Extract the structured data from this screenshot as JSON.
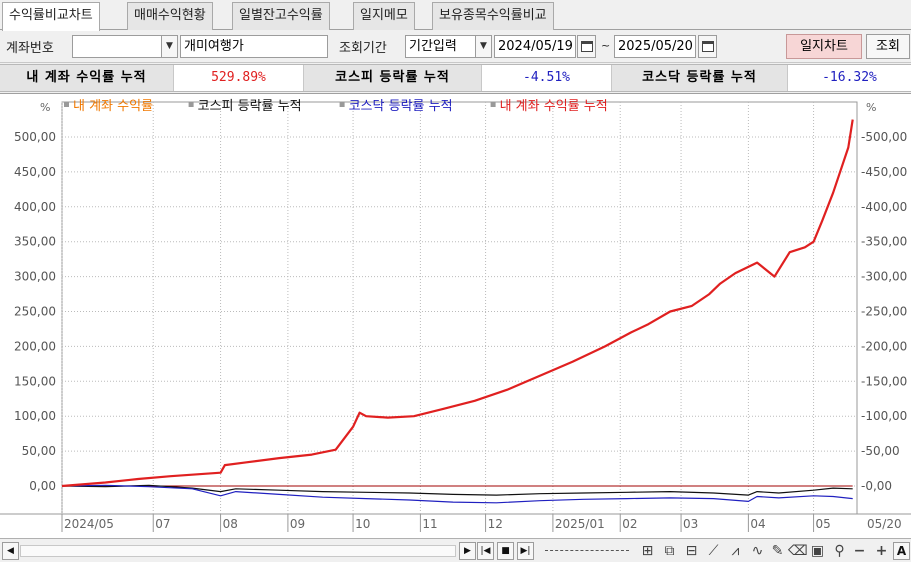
{
  "tabs": [
    {
      "label": "수익률비교차트",
      "active": true
    },
    {
      "label": "매매수익현황",
      "active": false
    },
    {
      "label": "일별잔고수익률",
      "active": false
    },
    {
      "label": "일지메모",
      "active": false
    },
    {
      "label": "보유종목수익률비교",
      "active": false
    }
  ],
  "toolbar": {
    "account_label": "계좌번호",
    "account_value": "",
    "account_name": "개미여행가",
    "period_label": "조회기간",
    "period_mode": "기간입력",
    "start_date": "2024/05/19",
    "tilde": "~",
    "end_date": "2025/05/20",
    "journal_chart_label": "일지차트",
    "query_label": "조회"
  },
  "summary": {
    "my_label": "내 계좌 수익률 누적",
    "my_value": "529.89%",
    "kospi_label": "코스피 등락률 누적",
    "kospi_value": "-4.51%",
    "kosdaq_label": "코스닥 등락률 누적",
    "kosdaq_value": "-16.32%"
  },
  "colors": {
    "my": "#e02020",
    "my_legend": "#f07800",
    "kospi": "#111111",
    "kosdaq": "#2020c0",
    "grid": "#bbbbbb"
  },
  "chart_data": {
    "type": "line",
    "unit_label": "%",
    "legend": [
      {
        "name": "내 계좌 수익률",
        "color": "#f07800"
      },
      {
        "name": "코스피 등락률 누적",
        "color": "#111111"
      },
      {
        "name": "코스닥 등락률 누적",
        "color": "#2020c0"
      },
      {
        "name": "내 계좌 수익률 누적",
        "color": "#e02020"
      }
    ],
    "yticks": [
      "500,00",
      "450,00",
      "400,00",
      "350,00",
      "300,00",
      "250,00",
      "200,00",
      "150,00",
      "100,00",
      "50,00",
      "0,00"
    ],
    "ytick_values": [
      500,
      450,
      400,
      350,
      300,
      250,
      200,
      150,
      100,
      50,
      0
    ],
    "ylim": [
      -30,
      540
    ],
    "xticks": [
      "2024/05",
      "07",
      "08",
      "09",
      "10",
      "11",
      "12",
      "2025/01",
      "02",
      "03",
      "04",
      "05"
    ],
    "xtick_days": [
      0,
      42,
      73,
      104,
      134,
      165,
      195,
      226,
      257,
      285,
      316,
      346
    ],
    "last_x_label": "05/20",
    "x_end_day": 366,
    "series": [
      {
        "name": "내 계좌 수익률 누적",
        "color": "#e02020",
        "x": [
          0,
          20,
          35,
          50,
          73,
          75,
          85,
          100,
          115,
          126,
          134,
          137,
          140,
          150,
          162,
          175,
          190,
          205,
          220,
          235,
          250,
          262,
          270,
          280,
          290,
          298,
          303,
          310,
          320,
          328,
          335,
          342,
          346,
          350,
          355,
          362,
          364
        ],
        "y": [
          0,
          5,
          10,
          14,
          19,
          30,
          34,
          40,
          45,
          52,
          85,
          105,
          100,
          98,
          100,
          110,
          122,
          138,
          158,
          178,
          200,
          220,
          232,
          250,
          258,
          275,
          290,
          305,
          320,
          300,
          335,
          342,
          350,
          380,
          420,
          485,
          525
        ]
      },
      {
        "name": "코스피 등락률 누적",
        "color": "#111111",
        "x": [
          0,
          20,
          40,
          60,
          73,
          80,
          100,
          120,
          140,
          160,
          180,
          200,
          220,
          240,
          260,
          280,
          300,
          316,
          320,
          330,
          346,
          355,
          364
        ],
        "y": [
          0,
          -1,
          1,
          -3,
          -8,
          -4,
          -6,
          -8,
          -9,
          -10,
          -12,
          -13,
          -11,
          -10,
          -9,
          -8,
          -10,
          -13,
          -8,
          -10,
          -6,
          -3,
          -4
        ]
      },
      {
        "name": "코스닥 등락률 누적",
        "color": "#2020c0",
        "x": [
          0,
          20,
          40,
          60,
          73,
          80,
          100,
          120,
          140,
          160,
          180,
          200,
          220,
          240,
          260,
          280,
          300,
          316,
          320,
          330,
          346,
          355,
          364
        ],
        "y": [
          0,
          1,
          -1,
          -4,
          -14,
          -8,
          -12,
          -16,
          -18,
          -20,
          -23,
          -24,
          -21,
          -19,
          -18,
          -17,
          -18,
          -22,
          -15,
          -17,
          -14,
          -15,
          -18
        ]
      }
    ]
  },
  "bottom": {
    "left_arrow": "◀",
    "right_arrow": "▶",
    "first_btn": "|◀",
    "stop_btn": "■",
    "next_btn": "▶|",
    "zoom_out": "−",
    "zoom_in": "+",
    "corner": "A"
  }
}
